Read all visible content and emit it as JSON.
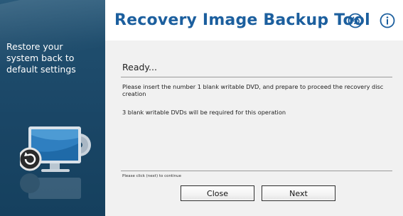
{
  "sidebar": {
    "lines": [
      "Restore your",
      "system back to",
      "default settings"
    ]
  },
  "header": {
    "title": "Recovery Image Backup Tool",
    "icons": [
      "back-arrow-icon",
      "info-icon"
    ],
    "accent_color": "#1c5f9e"
  },
  "main": {
    "status": "Ready...",
    "message_primary": "Please insert the  number 1  blank writable DVD, and prepare to proceed the recovery disc creation",
    "message_secondary": "3 blank writable DVDs will be required for this operation",
    "hint": "Please click (next) to continue"
  },
  "buttons": {
    "close_label": "Close",
    "next_label": "Next"
  }
}
